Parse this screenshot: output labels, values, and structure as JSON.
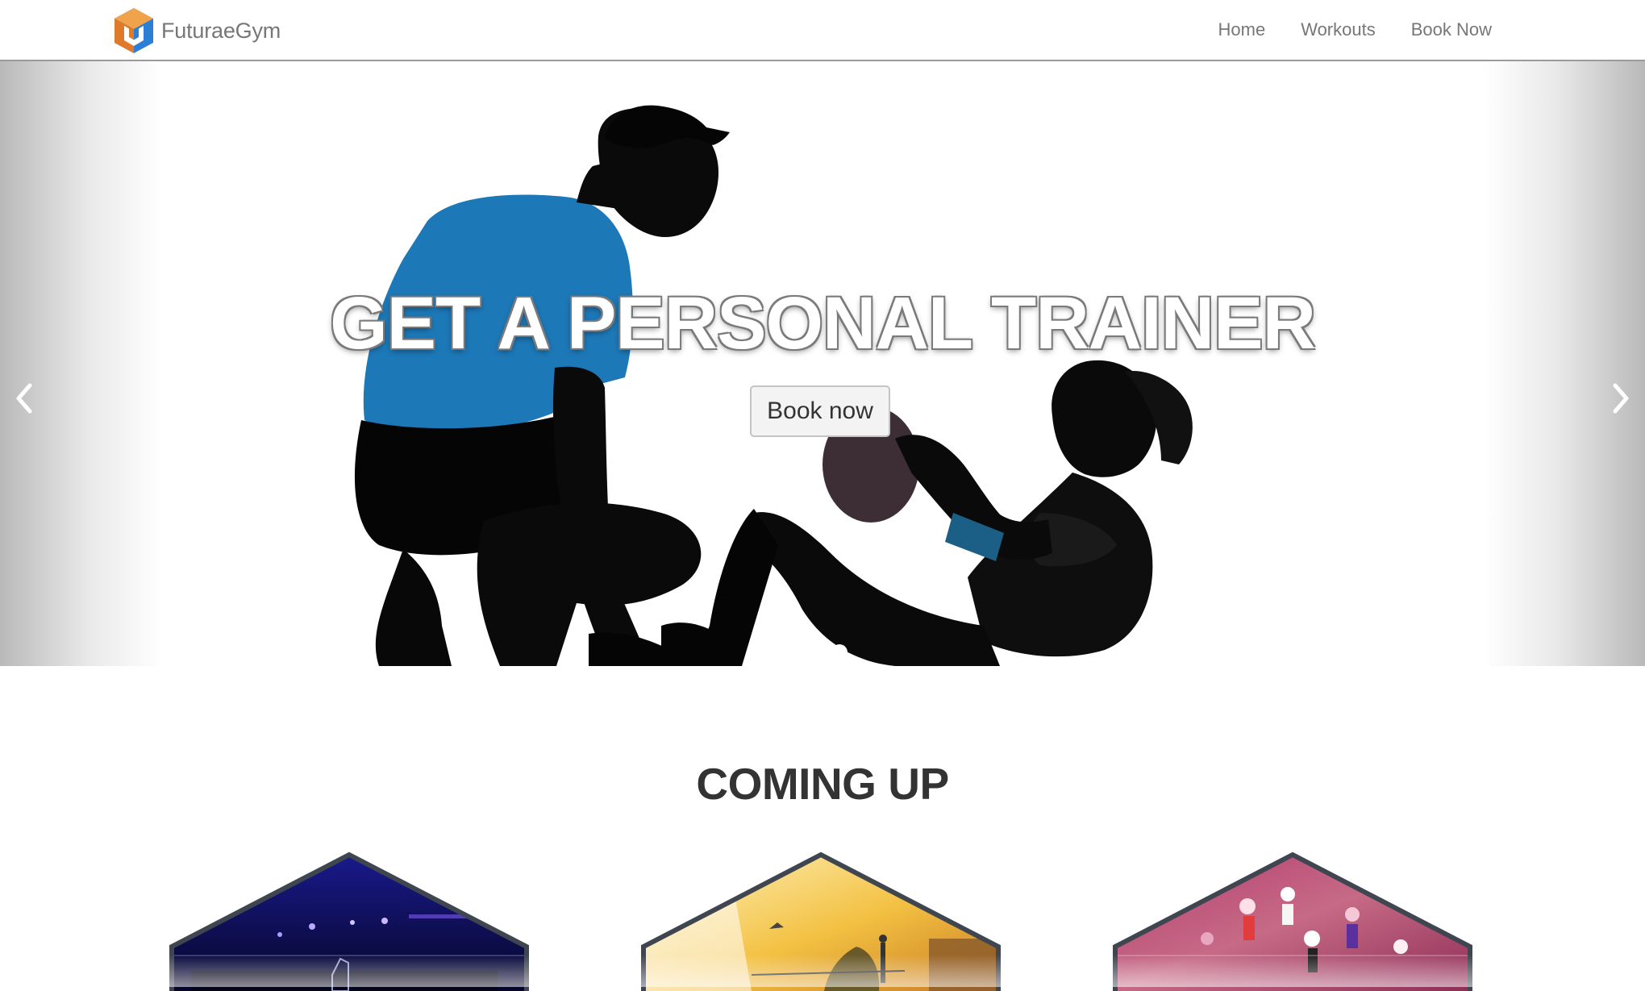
{
  "brand": {
    "name": "FuturaeGym",
    "logo_icon": "cube-logo-icon"
  },
  "nav": {
    "items": [
      {
        "label": "Home"
      },
      {
        "label": "Workouts"
      },
      {
        "label": "Book Now"
      }
    ]
  },
  "hero": {
    "title": "GET A PERSONAL TRAINER",
    "button_label": "Book now",
    "prev_icon": "chevron-left-icon",
    "next_icon": "chevron-right-icon",
    "slide_count": 1,
    "active_slide": 1
  },
  "section": {
    "title": "COMING UP"
  },
  "cards": [
    {
      "image": "gym-hall-blue-lights"
    },
    {
      "image": "outdoor-sunset-fitness"
    },
    {
      "image": "dance-class-pink"
    }
  ],
  "colors": {
    "logo_orange": "#e07a2b",
    "logo_blue": "#2c7fd4",
    "nav_text": "#777777",
    "card_border": "#3f4650"
  }
}
